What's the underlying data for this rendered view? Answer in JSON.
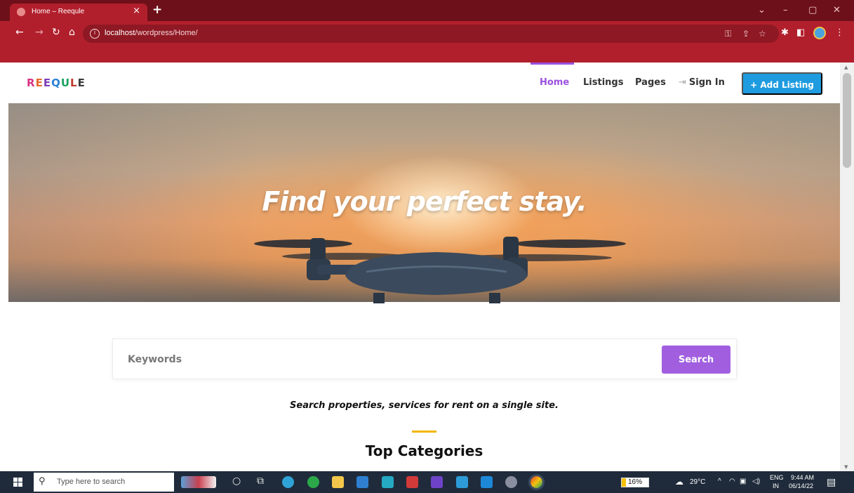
{
  "browser": {
    "tab_title": "Home – Reequle",
    "tab_close": "×",
    "new_tab": "+",
    "url_host": "localhost",
    "url_path": "/wordpress/Home/",
    "window_controls": [
      "⌄",
      "–",
      "▢",
      "✕"
    ]
  },
  "site": {
    "logo": "REEQULE",
    "nav": [
      {
        "label": "Home",
        "active": true
      },
      {
        "label": "Listings",
        "active": false
      },
      {
        "label": "Pages",
        "active": false
      },
      {
        "label": "Sign In",
        "active": false
      }
    ],
    "add_listing_label": "+ Add Listing",
    "accent_color": "#9b51e0",
    "button_color": "#1f9ce0"
  },
  "hero": {
    "title": "Find your perfect stay."
  },
  "search": {
    "placeholder": "Keywords",
    "button_label": "Search"
  },
  "tagline": "Search properties, services for rent on a single site.",
  "section_title": "Top Categories",
  "taskbar": {
    "search_placeholder": "Type here to search",
    "battery": "16%",
    "weather": "29°C",
    "language_top": "ENG",
    "language_bottom": "IN",
    "time": "9:44 AM",
    "date": "06/14/22"
  }
}
